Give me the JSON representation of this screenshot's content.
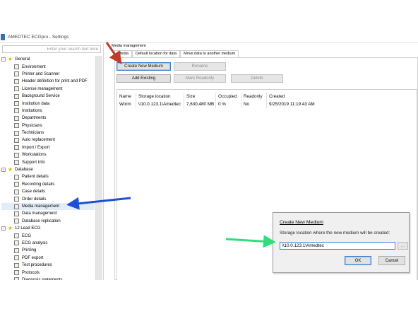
{
  "window": {
    "title": "AMEDTEC ECGpro  -  Settings"
  },
  "search": {
    "placeholder": "Enter your search text here"
  },
  "tree": [
    {
      "group": "General",
      "items": [
        "Environment",
        "Printer and Scanner",
        "Header definition for print and PDF",
        "License management",
        "Background Service",
        "Institution data",
        "Institutions",
        "Departments",
        "Physicians",
        "Technicians",
        "Auto replacement",
        "Import / Export",
        "Workstations",
        "Support Info"
      ]
    },
    {
      "group": "Database",
      "items": [
        "Patient details",
        "Recording details",
        "Case details",
        "Order details",
        "Media management",
        "Data management",
        "Database replication"
      ]
    },
    {
      "group": "12 Lead ECG",
      "items": [
        "ECG",
        "ECG analysis",
        "Printing",
        "PDF export",
        "Test procedures",
        "Protocols",
        "Diagnosis statements"
      ]
    }
  ],
  "selected_item": "Media management",
  "content": {
    "section_title": "Media management",
    "tabs": [
      "Media",
      "Default location for data",
      "Move data to another medium"
    ],
    "buttons": {
      "create_new_medium": "Create New Medium",
      "rename": "Rename",
      "add_existing": "Add Existing",
      "mark_readonly": "Mark Readonly",
      "delete": "Delete"
    },
    "table": {
      "columns": [
        "Name",
        "Storage location",
        "Size",
        "Occupied",
        "Readonly",
        "Created"
      ],
      "rows": [
        [
          "Worm",
          "\\\\10.0.123.1\\Amedtec",
          "7,630,480 MB",
          "0 %",
          "No",
          "9/25/2019 11:19:43 AM"
        ]
      ]
    }
  },
  "dialog": {
    "title": "Create New Medium",
    "message": "Storage location where the new medium will be created:",
    "input_value": "\\\\10.0.123.1\\Amedtec",
    "browse_label": "...",
    "ok": "OK",
    "cancel": "Cancel"
  },
  "annotation_colors": {
    "red": "#c0392b",
    "blue": "#1f4fd6",
    "green": "#2ee07a"
  }
}
